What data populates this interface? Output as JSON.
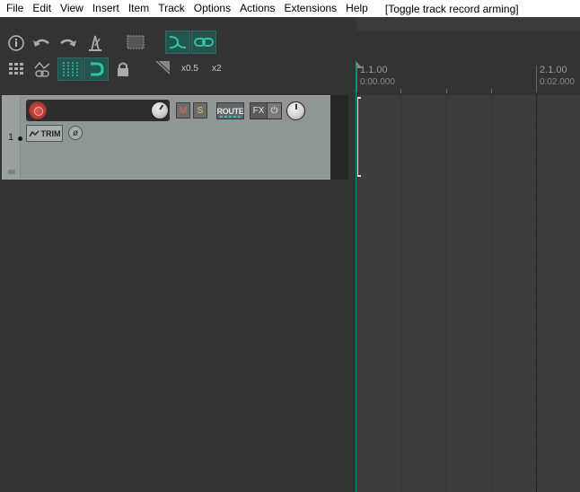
{
  "menubar": {
    "items": [
      "File",
      "Edit",
      "View",
      "Insert",
      "Item",
      "Track",
      "Options",
      "Actions",
      "Extensions",
      "Help"
    ],
    "action_hint": "[Toggle track record arming]"
  },
  "toolbar": {
    "zoom_half_label": "x0.5",
    "zoom_double_label": "x2"
  },
  "ruler": {
    "marks": [
      {
        "bar": "1.1.00",
        "time": "0:00.000"
      },
      {
        "bar": "2.1.00",
        "time": "0:02.000"
      }
    ]
  },
  "track": {
    "number": "1",
    "mute_label": "M",
    "solo_label": "S",
    "route_label": "ROUTE",
    "fx_label": "FX",
    "power_label": "⏻",
    "trim_label": "TRIM",
    "phase_label": "ø"
  },
  "colors": {
    "accent": "#2ec4a6",
    "track_panel": "#8f9694",
    "record": "#d0453f",
    "mute": "#d9534f",
    "solo": "#e0c060"
  }
}
